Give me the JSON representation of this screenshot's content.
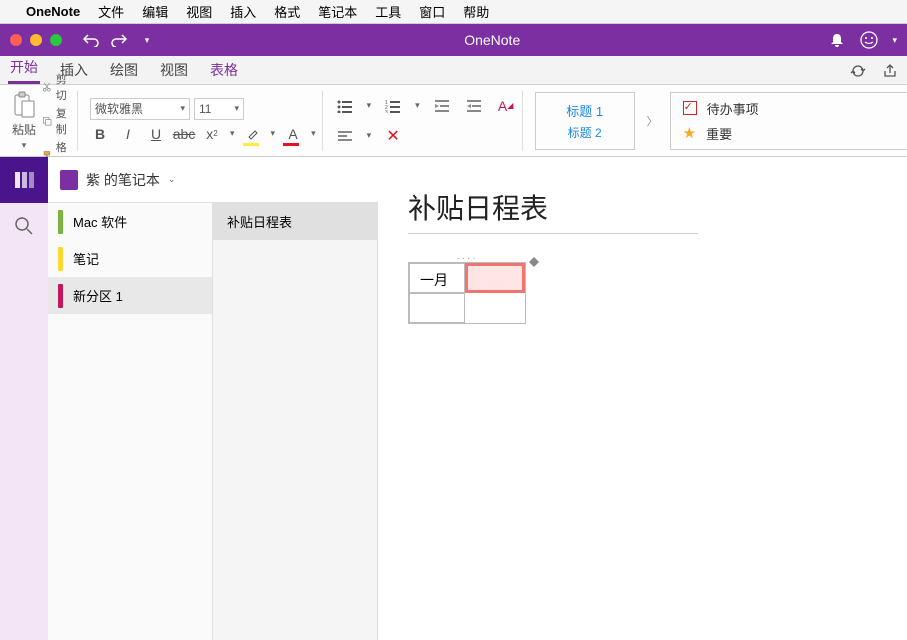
{
  "mac_menu": {
    "app": "OneNote",
    "items": [
      "文件",
      "编辑",
      "视图",
      "插入",
      "格式",
      "笔记本",
      "工具",
      "窗口",
      "帮助"
    ]
  },
  "title_bar": {
    "title": "OneNote"
  },
  "tabs": {
    "items": [
      "开始",
      "插入",
      "绘图",
      "视图",
      "表格"
    ],
    "active_index": 4
  },
  "ribbon": {
    "paste": "粘贴",
    "cut": "剪切",
    "copy": "复制",
    "format_brush": "格式",
    "font_name": "微软雅黑",
    "font_size": "11",
    "styles": {
      "h1": "标题 1",
      "h2": "标题 2"
    },
    "tags": {
      "todo": "待办事项",
      "important": "重要"
    }
  },
  "notebook": {
    "name": "紫 的笔记本",
    "sections": [
      {
        "label": "Mac 软件",
        "color": "sc-green"
      },
      {
        "label": "笔记",
        "color": "sc-yellow"
      },
      {
        "label": "新分区 1",
        "color": "sc-magenta"
      }
    ],
    "active_section": 2,
    "pages": [
      "补贴日程表"
    ],
    "active_page": 0
  },
  "page": {
    "title": "补贴日程表",
    "table_cell_0_0": "一月"
  }
}
